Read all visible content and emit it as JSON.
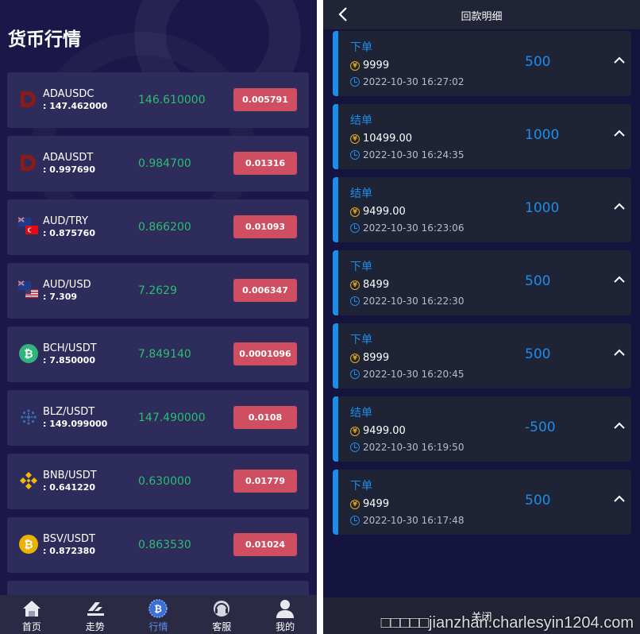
{
  "left": {
    "title": "货币行情",
    "rows": [
      {
        "pair": "ADAUSDC",
        "sub": ": 147.462000",
        "price": "146.610000",
        "change": "0.005791",
        "icon": "ada-icon"
      },
      {
        "pair": "ADAUSDT",
        "sub": ": 0.997690",
        "price": "0.984700",
        "change": "0.01316",
        "icon": "ada-icon"
      },
      {
        "pair": "AUD/TRY",
        "sub": ": 0.875760",
        "price": "0.866200",
        "change": "0.01093",
        "icon": "aud-try-flags-icon"
      },
      {
        "pair": "AUD/USD",
        "sub": ": 7.309",
        "price": "7.2629",
        "change": "0.006347",
        "icon": "aud-usd-flags-icon"
      },
      {
        "pair": "BCH/USDT",
        "sub": ": 7.850000",
        "price": "7.849140",
        "change": "0.0001096",
        "icon": "bch-icon"
      },
      {
        "pair": "BLZ/USDT",
        "sub": ": 149.099000",
        "price": "147.490000",
        "change": "0.0108",
        "icon": "blz-icon"
      },
      {
        "pair": "BNB/USDT",
        "sub": ": 0.641220",
        "price": "0.630000",
        "change": "0.01779",
        "icon": "bnb-icon"
      },
      {
        "pair": "BSV/USDT",
        "sub": ": 0.872380",
        "price": "0.863530",
        "change": "0.01024",
        "icon": "bsv-icon"
      }
    ],
    "tabs": [
      {
        "label": "首页",
        "icon": "home-icon"
      },
      {
        "label": "走势",
        "icon": "trend-icon"
      },
      {
        "label": "行情",
        "icon": "bitcoin-icon",
        "active": true
      },
      {
        "label": "客服",
        "icon": "headset-icon"
      },
      {
        "label": "我的",
        "icon": "user-icon"
      }
    ]
  },
  "right": {
    "title": "回款明细",
    "records": [
      {
        "type": "下单",
        "amount": "9999",
        "time": "2022-10-30 16:27:02",
        "value": "500"
      },
      {
        "type": "结单",
        "amount": "10499.00",
        "time": "2022-10-30 16:24:35",
        "value": "1000"
      },
      {
        "type": "结单",
        "amount": "9499.00",
        "time": "2022-10-30 16:23:06",
        "value": "1000"
      },
      {
        "type": "下单",
        "amount": "8499",
        "time": "2022-10-30 16:22:30",
        "value": "500"
      },
      {
        "type": "下单",
        "amount": "8999",
        "time": "2022-10-30 16:20:45",
        "value": "500"
      },
      {
        "type": "结单",
        "amount": "9499.00",
        "time": "2022-10-30 16:19:50",
        "value": "-500"
      },
      {
        "type": "下单",
        "amount": "9499",
        "time": "2022-10-30 16:17:48",
        "value": "500"
      }
    ],
    "close_label": "关闭",
    "watermark": "□□□□□jianzhan.charlesyin1204.com"
  },
  "colors": {
    "accent_blue": "#1e8ce8",
    "price_green": "#2fbb72",
    "change_red": "#cf4e62",
    "tab_active": "#5b8ce8"
  }
}
